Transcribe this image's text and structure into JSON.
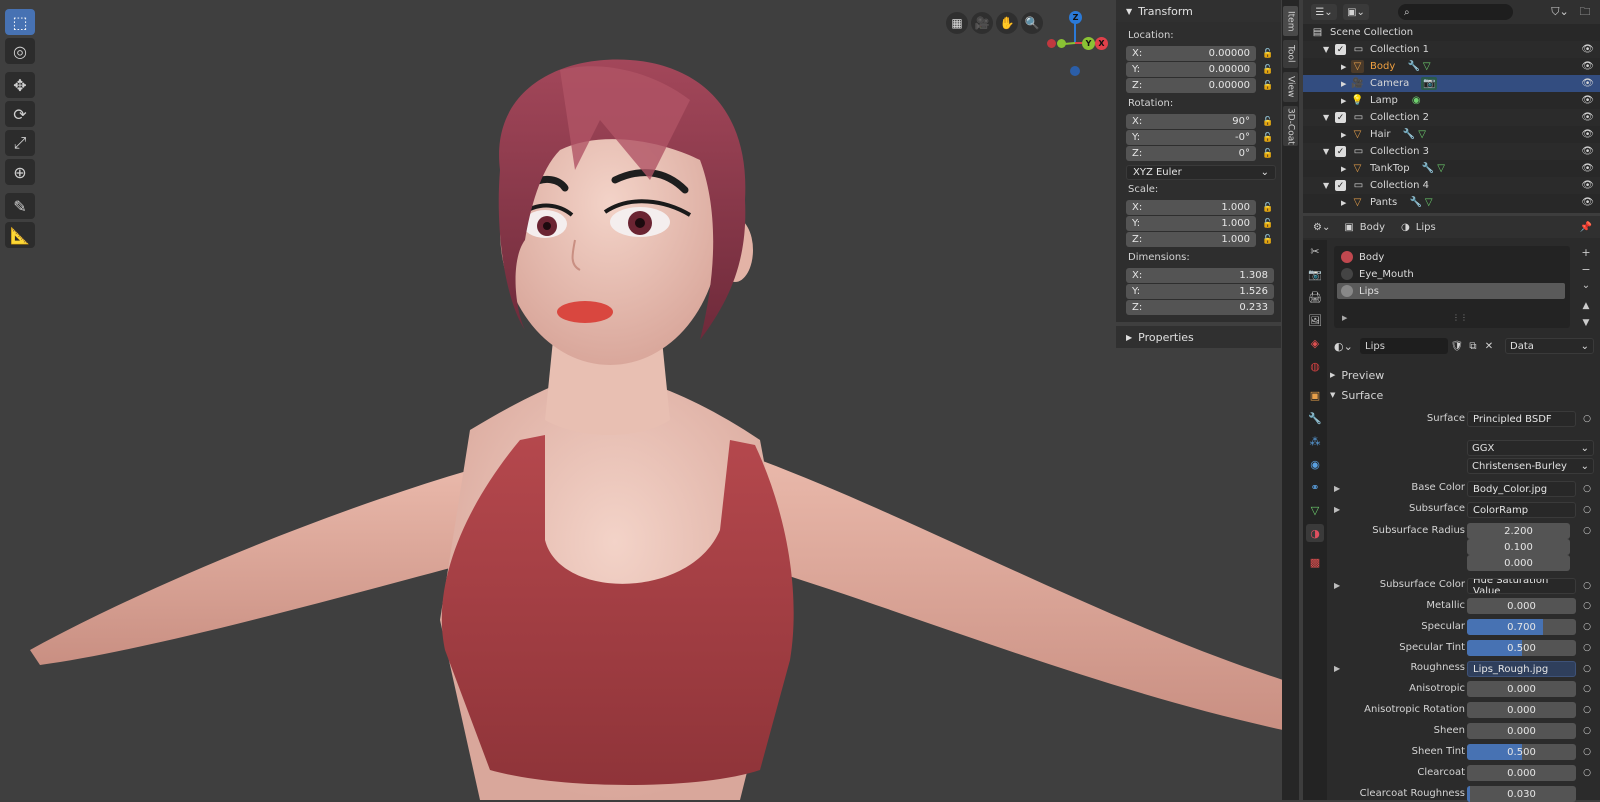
{
  "outliner": {
    "search_placeholder": "",
    "rows": [
      {
        "label": "Scene Collection",
        "kind": "scene"
      },
      {
        "label": "Collection 1",
        "kind": "collection"
      },
      {
        "label": "Body",
        "kind": "mesh"
      },
      {
        "label": "Camera",
        "kind": "camera"
      },
      {
        "label": "Lamp",
        "kind": "light"
      },
      {
        "label": "Collection 2",
        "kind": "collection"
      },
      {
        "label": "Hair",
        "kind": "mesh"
      },
      {
        "label": "Collection 3",
        "kind": "collection"
      },
      {
        "label": "TankTop",
        "kind": "mesh"
      },
      {
        "label": "Collection 4",
        "kind": "collection"
      },
      {
        "label": "Pants",
        "kind": "mesh"
      }
    ]
  },
  "npanel": {
    "tabs": [
      "Item",
      "Tool",
      "View",
      "3D-Coat"
    ],
    "transform_title": "Transform",
    "location_label": "Location:",
    "location": {
      "x": "0.00000",
      "y": "0.00000",
      "z": "0.00000"
    },
    "rotation_label": "Rotation:",
    "rotation": {
      "x": "90°",
      "y": "-0°",
      "z": "0°"
    },
    "rotation_mode": "XYZ Euler",
    "scale_label": "Scale:",
    "scale": {
      "x": "1.000",
      "y": "1.000",
      "z": "1.000"
    },
    "dimensions_label": "Dimensions:",
    "dimensions": {
      "x": "1.308",
      "y": "1.526",
      "z": "0.233"
    },
    "axis": {
      "x": "X:",
      "y": "Y:",
      "z": "Z:"
    },
    "properties_title": "Properties"
  },
  "gizmo": {
    "z": "Z",
    "x": "X",
    "y": "Y"
  },
  "props": {
    "breadcrumb_object": "Body",
    "breadcrumb_material": "Lips",
    "slots": [
      "Body",
      "Eye_Mouth",
      "Lips"
    ],
    "material_name": "Lips",
    "data_mode": "Data",
    "preview_label": "Preview",
    "surface_label": "Surface",
    "rows": {
      "surface": {
        "label": "Surface",
        "value": "Principled BSDF"
      },
      "distribution": "GGX",
      "subsurface_method": "Christensen-Burley",
      "base_color": {
        "label": "Base Color",
        "value": "Body_Color.jpg"
      },
      "subsurface": {
        "label": "Subsurface",
        "value": "ColorRamp"
      },
      "subsurface_radius": {
        "label": "Subsurface Radius",
        "values": [
          "2.200",
          "0.100",
          "0.000"
        ]
      },
      "subsurface_color": {
        "label": "Subsurface Color",
        "value": "Hue Saturation Value"
      },
      "metallic": {
        "label": "Metallic",
        "value": "0.000",
        "fill": 0
      },
      "specular": {
        "label": "Specular",
        "value": "0.700",
        "fill": 0.7
      },
      "specular_tint": {
        "label": "Specular Tint",
        "value": "0.500",
        "fill": 0.5
      },
      "roughness": {
        "label": "Roughness",
        "value": "Lips_Rough.jpg"
      },
      "anisotropic": {
        "label": "Anisotropic",
        "value": "0.000",
        "fill": 0
      },
      "anisotropic_rotation": {
        "label": "Anisotropic Rotation",
        "value": "0.000",
        "fill": 0
      },
      "sheen": {
        "label": "Sheen",
        "value": "0.000",
        "fill": 0
      },
      "sheen_tint": {
        "label": "Sheen Tint",
        "value": "0.500",
        "fill": 0.5
      },
      "clearcoat": {
        "label": "Clearcoat",
        "value": "0.000",
        "fill": 0
      },
      "clearcoat_roughness": {
        "label": "Clearcoat Roughness",
        "value": "0.030",
        "fill": 0.03
      }
    }
  },
  "colors": {
    "accent": "#4772b3",
    "selected_row": "#334d80",
    "active_object": "#f0a040"
  }
}
